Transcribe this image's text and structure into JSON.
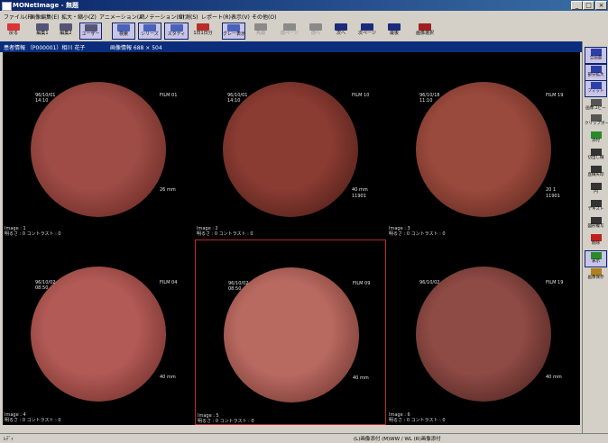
{
  "window": {
    "title": "MONetImage - 無題"
  },
  "menu": [
    {
      "label": "ファイル(F)"
    },
    {
      "label": "画像編集(E)"
    },
    {
      "label": "拡大・縮小(Z)"
    },
    {
      "label": "アニメーション(A)"
    },
    {
      "label": "アノテーション(N)"
    },
    {
      "label": "計測(S)"
    },
    {
      "label": "レポート(R)"
    },
    {
      "label": "表示(V)"
    },
    {
      "label": "その他(O)"
    }
  ],
  "toolbar": [
    {
      "label": "戻る",
      "icon": "return-icon",
      "enabled": true,
      "pressed": false,
      "color": "#d9353a"
    },
    {
      "label": "編集1",
      "icon": "edit1-icon",
      "enabled": true,
      "pressed": false,
      "color": "#555577"
    },
    {
      "label": "編集2",
      "icon": "edit2-icon",
      "enabled": true,
      "pressed": false,
      "color": "#555577"
    },
    {
      "label": "ユーザー",
      "icon": "user-icon",
      "enabled": true,
      "pressed": true,
      "color": "#555577"
    },
    {
      "label": "検索",
      "icon": "search-icon",
      "enabled": true,
      "pressed": true,
      "color": "#4a62b8"
    },
    {
      "label": "シリーズ",
      "icon": "series-icon",
      "enabled": true,
      "pressed": true,
      "color": "#4a62b8"
    },
    {
      "label": "スタディ",
      "icon": "study-icon",
      "enabled": true,
      "pressed": true,
      "color": "#4a62b8"
    },
    {
      "label": "1日1日分",
      "icon": "day-icon",
      "enabled": true,
      "pressed": false,
      "color": "#b82c2c"
    },
    {
      "label": "グレー表示",
      "icon": "gray-icon",
      "enabled": true,
      "pressed": true,
      "color": "#4a62b8"
    },
    {
      "label": "先頭",
      "icon": "first-icon",
      "enabled": false,
      "pressed": false,
      "color": "#8a8a8a"
    },
    {
      "label": "前ページ",
      "icon": "prev-page-icon",
      "enabled": false,
      "pressed": false,
      "color": "#8a8a8a"
    },
    {
      "label": "前へ",
      "icon": "prev-icon",
      "enabled": false,
      "pressed": false,
      "color": "#8a8a8a"
    },
    {
      "label": "次へ",
      "icon": "next-icon",
      "enabled": true,
      "pressed": false,
      "color": "#1b2b7a"
    },
    {
      "label": "次ページ",
      "icon": "next-page-icon",
      "enabled": true,
      "pressed": false,
      "color": "#1b2b7a"
    },
    {
      "label": "最後",
      "icon": "last-icon",
      "enabled": true,
      "pressed": false,
      "color": "#1b2b7a"
    },
    {
      "label": "画像選択",
      "icon": "image-select-icon",
      "enabled": true,
      "pressed": false,
      "color": "#a02020"
    }
  ],
  "info": {
    "patient": "患者情報 （P000001）相川 花子",
    "image_info": "画像情報 688 × 504"
  },
  "images": [
    {
      "caption": "Image : 1",
      "adjust": "明るさ : 0  コントラスト : 0",
      "date": "96/10/01",
      "time": "14:10",
      "film": "FILM 01",
      "meta": "26 mm",
      "id": "",
      "bg": "#9e4c45",
      "dark": "#5a1f1c"
    },
    {
      "caption": "Image : 2",
      "adjust": "明るさ : 0  コントラスト : 0",
      "date": "96/10/01",
      "time": "14:10",
      "film": "FILM 10",
      "meta": "40 mm",
      "id": "11901",
      "bg": "#8a3b32",
      "dark": "#3d1712"
    },
    {
      "caption": "Image : 3",
      "adjust": "明るさ : 0  コントラスト : 0",
      "date": "96/10/18",
      "time": "11:10",
      "film": "FILM 19",
      "meta": "20 1",
      "id": "11901",
      "bg": "#9a4a3c",
      "dark": "#4d1e18"
    },
    {
      "caption": "Image : 4",
      "adjust": "明るさ : 0  コントラスト : 0",
      "date": "96/10/02",
      "time": "08:50",
      "film": "FILM 04",
      "meta": "40 mm",
      "id": "",
      "bg": "#b25a55",
      "dark": "#5e2220"
    },
    {
      "caption": "Image : 5",
      "adjust": "明るさ : 0  コントラスト : 0",
      "date": "96/10/02",
      "time": "08:50",
      "film": "FILM 09",
      "meta": "40 mm",
      "id": "",
      "bg": "#b86a60",
      "dark": "#602824"
    },
    {
      "caption": "Image : 6",
      "adjust": "明るさ : 0  コントラスト : 0",
      "date": "96/10/02",
      "time": "",
      "film": "FILM 19",
      "meta": "40 mm",
      "id": "",
      "bg": "#8e4a44",
      "dark": "#3d1a18"
    }
  ],
  "sidepanel": [
    {
      "label": "全画面",
      "icon": "fullscreen-icon",
      "pressed": true,
      "color": "#2c3fa8"
    },
    {
      "label": "部分拡大",
      "icon": "partial-zoom-icon",
      "pressed": true,
      "color": "#2c3fa8"
    },
    {
      "label": "フィット",
      "icon": "fit-icon",
      "pressed": true,
      "color": "#2c3fa8"
    },
    {
      "label": "画像コピー",
      "icon": "image-copy-icon",
      "pressed": false,
      "color": "#555555"
    },
    {
      "label": "クリップボード",
      "icon": "clipboard-icon",
      "pressed": false,
      "color": "#555555"
    },
    {
      "label": "添付",
      "icon": "attach-icon",
      "pressed": false,
      "color": "#2a8a2a"
    },
    {
      "label": "切出し線",
      "icon": "cut-line-icon",
      "pressed": false,
      "color": "#333333"
    },
    {
      "label": "直線矢印",
      "icon": "arrow-icon",
      "pressed": false,
      "color": "#333333"
    },
    {
      "label": "円",
      "icon": "circle-icon",
      "pressed": false,
      "color": "#333333"
    },
    {
      "label": "テキスト",
      "icon": "text-icon",
      "pressed": false,
      "color": "#333333"
    },
    {
      "label": "図形複写",
      "icon": "shape-copy-icon",
      "pressed": false,
      "color": "#333333"
    },
    {
      "label": "削除",
      "icon": "delete-icon",
      "pressed": false,
      "color": "#c02020"
    },
    {
      "label": "表示",
      "icon": "display-icon",
      "pressed": true,
      "color": "#2a8a2a"
    },
    {
      "label": "画像保存",
      "icon": "save-image-icon",
      "pressed": false,
      "color": "#b08020"
    }
  ],
  "status": {
    "left": "ﾚﾃﾞｨ",
    "center": "(L)画像添付   (M)WW / WL   (R)画像添付"
  }
}
